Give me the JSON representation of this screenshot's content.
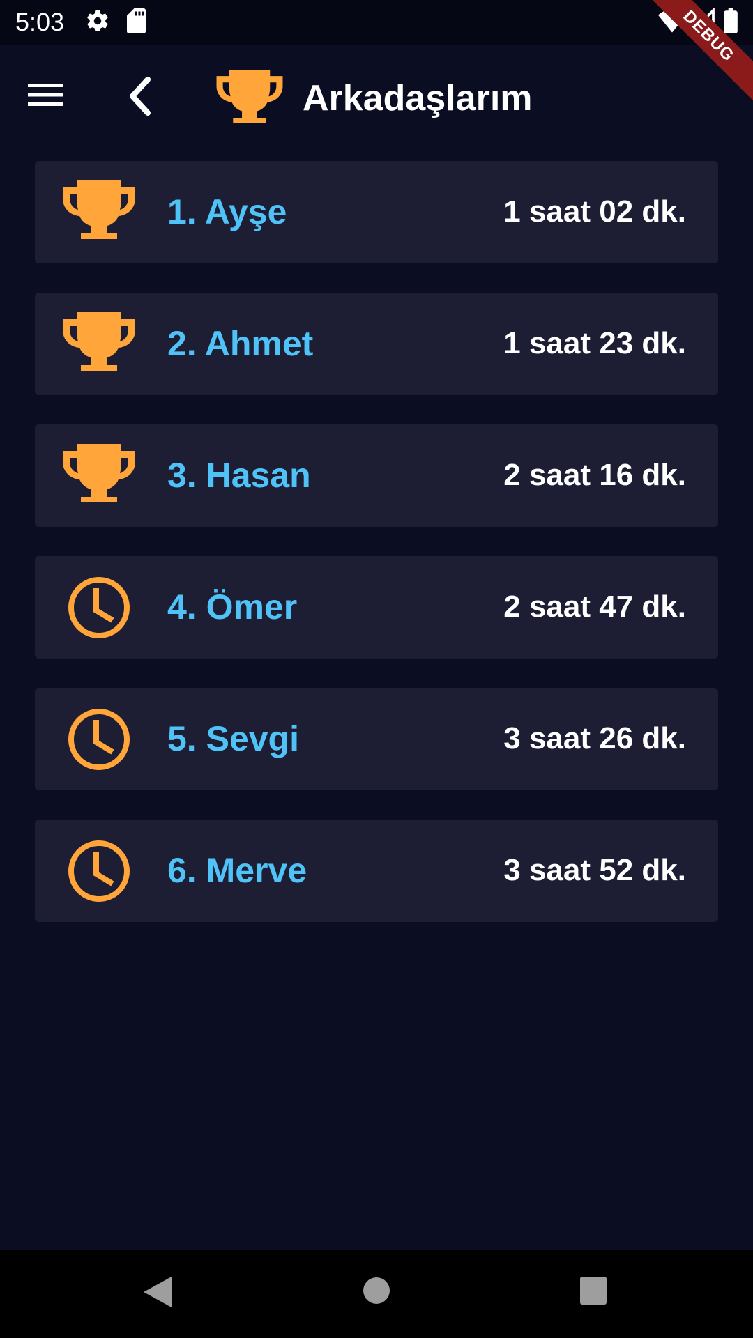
{
  "status_bar": {
    "time": "5:03",
    "icons": [
      "gear-icon",
      "sd-card-icon",
      "wifi-icon",
      "signal-icon",
      "battery-icon"
    ]
  },
  "debug_banner": {
    "label": "DEBUG"
  },
  "app_bar": {
    "title": "Arkadaşlarım",
    "menu_icon": "menu-icon",
    "back_icon": "chevron-left-icon",
    "title_icon": "trophy-icon"
  },
  "leaderboard": [
    {
      "name": "1. Ayşe",
      "time": "1 saat 02 dk.",
      "icon": "trophy-icon"
    },
    {
      "name": "2. Ahmet",
      "time": "1 saat 23 dk.",
      "icon": "trophy-icon"
    },
    {
      "name": "3. Hasan",
      "time": "2 saat 16 dk.",
      "icon": "trophy-icon"
    },
    {
      "name": "4. Ömer",
      "time": "2 saat 47 dk.",
      "icon": "clock-icon"
    },
    {
      "name": "5. Sevgi",
      "time": "3 saat 26 dk.",
      "icon": "clock-icon"
    },
    {
      "name": "6. Merve",
      "time": "3 saat 52 dk.",
      "icon": "clock-icon"
    }
  ],
  "nav_bar": {
    "icons": [
      "back-triangle-icon",
      "home-circle-icon",
      "recents-square-icon"
    ]
  },
  "colors": {
    "background": "#0b0e23",
    "card": "#1d1e34",
    "accent": "#ffa53a",
    "name_text": "#4fc3f7",
    "time_text": "#ffffff"
  }
}
